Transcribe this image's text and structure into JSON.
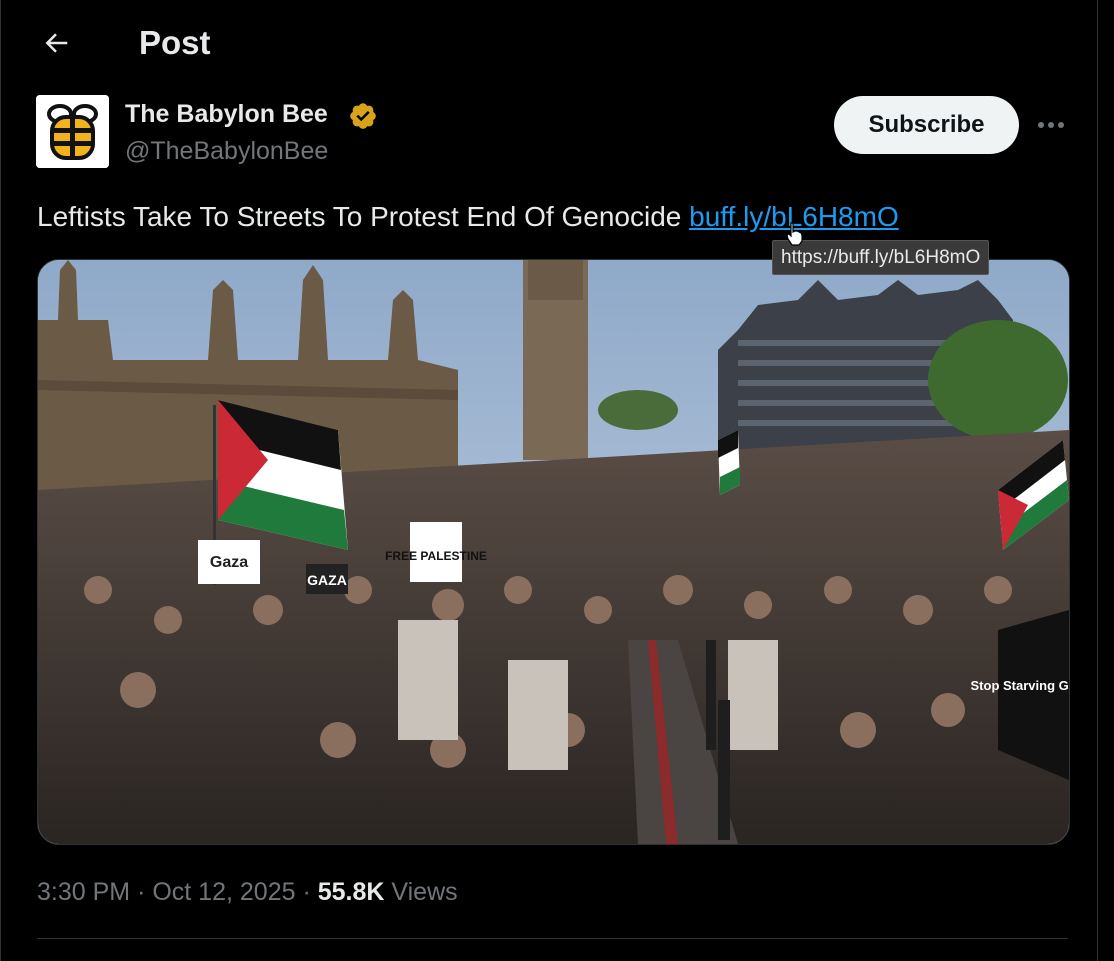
{
  "header": {
    "back_icon": "arrow-left-icon",
    "title": "Post"
  },
  "author": {
    "name": "The Babylon Bee",
    "handle": "@TheBabylonBee",
    "verified_icon": "verified-badge-icon",
    "verified_color": "#d8a31a"
  },
  "actions": {
    "subscribe_label": "Subscribe",
    "more_icon": "more-options-icon"
  },
  "tweet": {
    "text": "Leftists Take To Streets To Protest End Of Genocide",
    "link_text": "buff.ly/bL6H8mO",
    "tooltip": "https://buff.ly/bL6H8mO"
  },
  "media": {
    "sign_1": "Gaza",
    "sign_2": "FREE PALESTINE",
    "sign_3": "GAZA",
    "sign_4": "Stop Starving GAZA"
  },
  "meta": {
    "time": "3:30 PM",
    "separator": "·",
    "date": "Oct 12, 2025",
    "views_count": "55.8K",
    "views_label": "Views"
  },
  "colors": {
    "background": "#000000",
    "text_primary": "#e7e9ea",
    "text_secondary": "#71767b",
    "link": "#1d9bf0",
    "button_bg": "#eff3f4"
  }
}
